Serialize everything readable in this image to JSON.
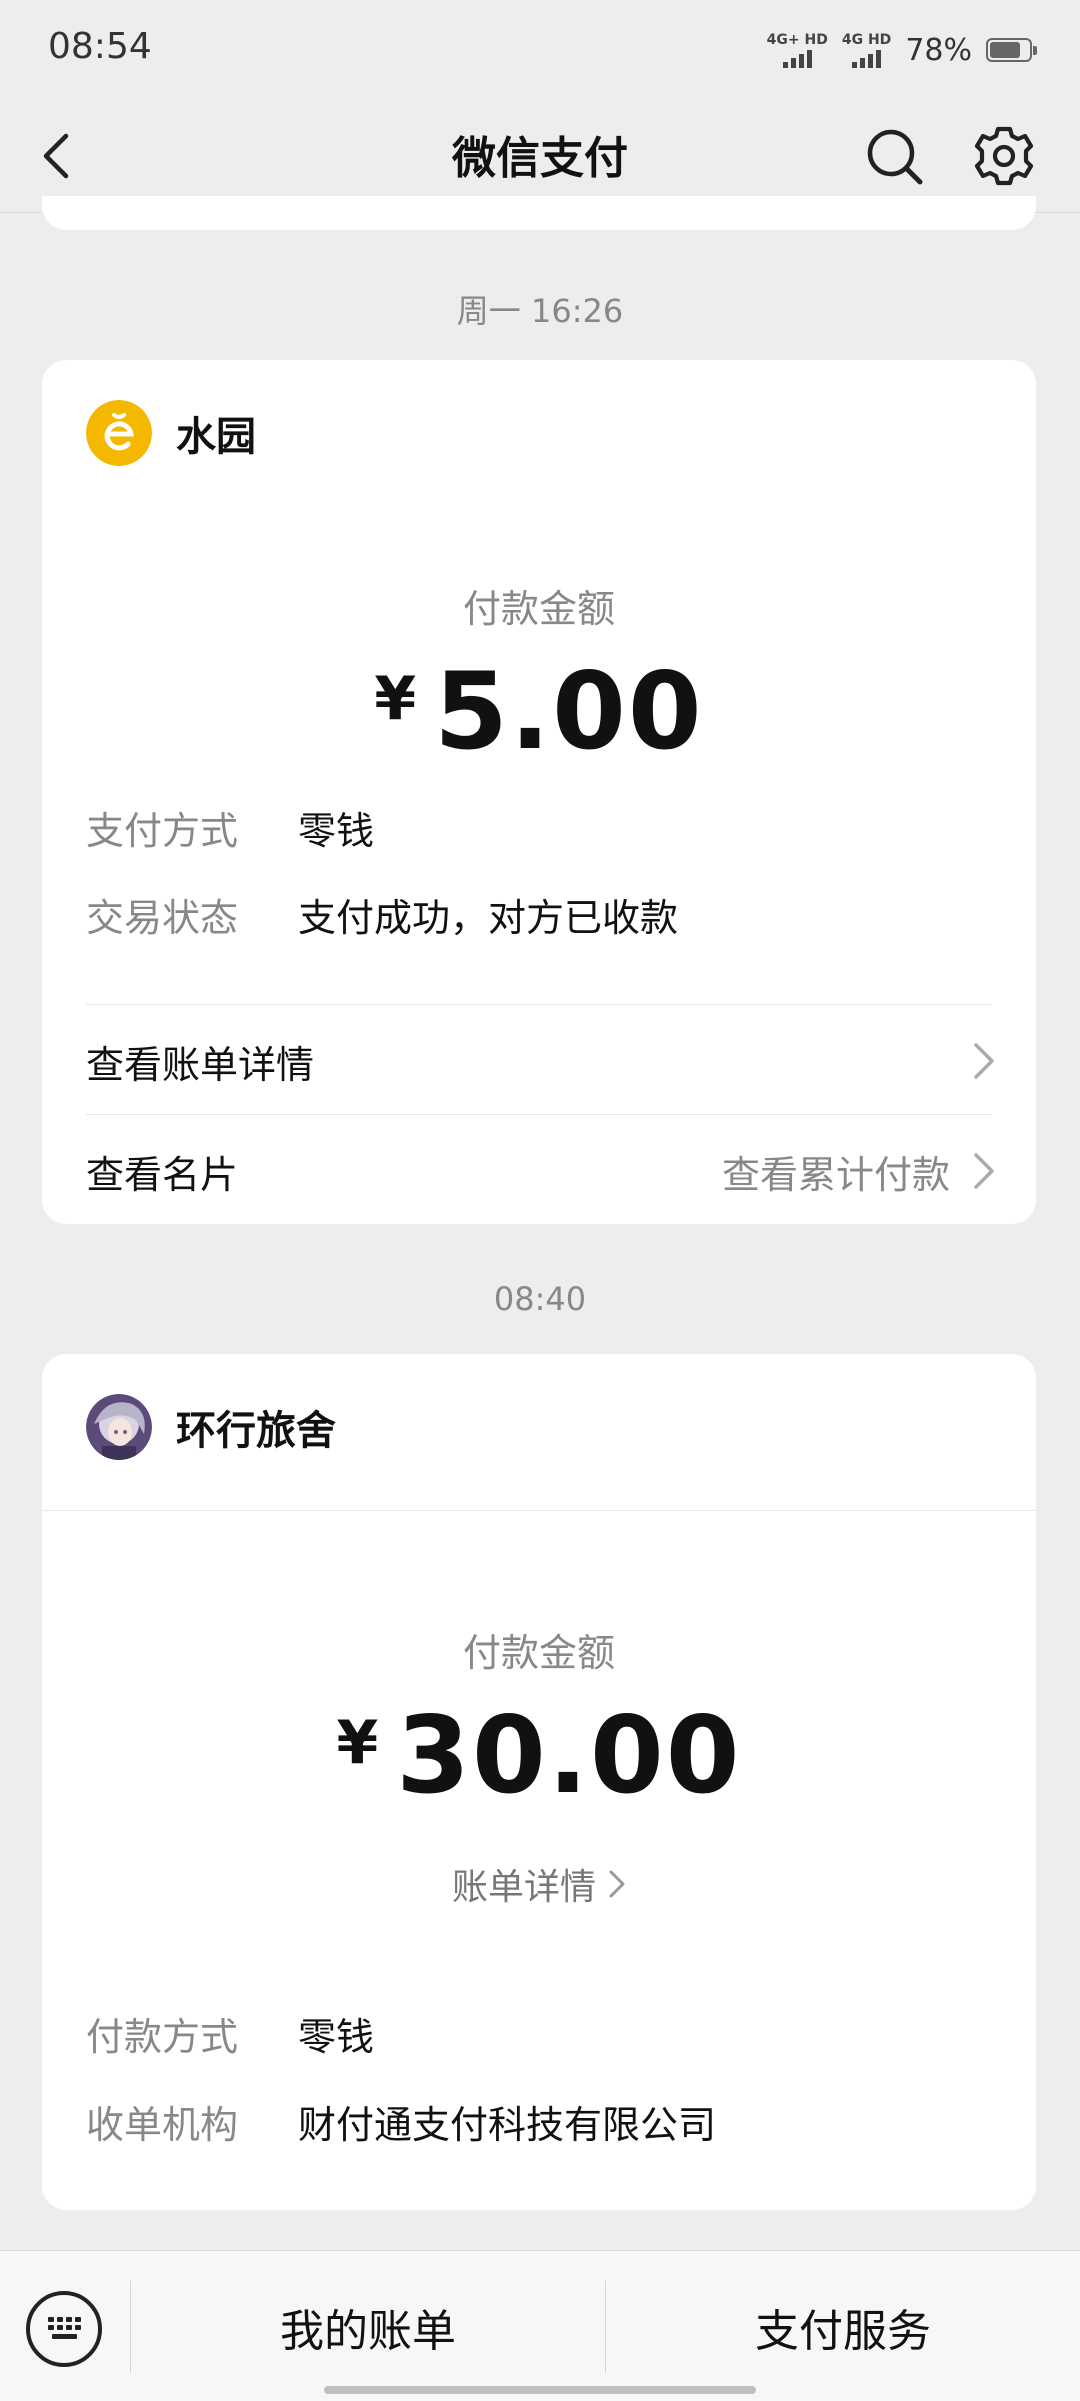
{
  "status_bar": {
    "time": "08:54",
    "signal1_label": "4G+ HD",
    "signal2_label": "4G HD",
    "battery": "78%",
    "battery_level": 0.78
  },
  "nav": {
    "title": "微信支付",
    "back_icon": "chevron-left-icon",
    "search_icon": "search-icon",
    "settings_icon": "gear-icon"
  },
  "messages": [
    {
      "timestamp": "周一 16:26",
      "merchant": "水园",
      "amount_label": "付款金额",
      "currency": "¥",
      "amount": "5.00",
      "details": [
        {
          "key": "支付方式",
          "value": "零钱"
        },
        {
          "key": "交易状态",
          "value": "支付成功，对方已收款"
        }
      ],
      "links": [
        {
          "label": "查看账单详情",
          "sub": ""
        },
        {
          "label": "查看名片",
          "sub": "查看累计付款"
        }
      ]
    },
    {
      "timestamp": "08:40",
      "merchant": "环行旅舍",
      "amount_label": "付款金额",
      "currency": "¥",
      "amount": "30.00",
      "detail_link": "账单详情",
      "details": [
        {
          "key": "付款方式",
          "value": "零钱"
        },
        {
          "key": "收单机构",
          "value": "财付通支付科技有限公司"
        }
      ]
    }
  ],
  "bottom_bar": {
    "keyboard_icon": "keyboard-icon",
    "item1": "我的账单",
    "item2": "支付服务"
  },
  "colors": {
    "background": "#ededed",
    "card": "#ffffff",
    "muted_text": "#888888",
    "merchant1_avatar": "#f5b800"
  }
}
